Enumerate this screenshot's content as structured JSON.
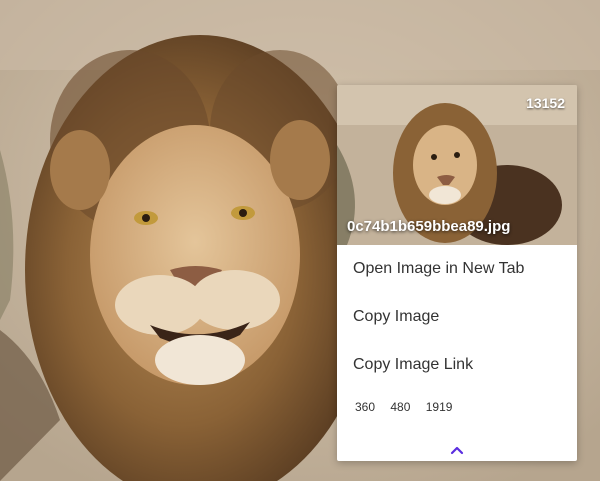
{
  "background_image": {
    "subject": "lion"
  },
  "popup": {
    "thumbnail": {
      "count_badge": "13152",
      "filename": "0c74b1b659bbea89.jpg"
    },
    "menu": {
      "open_new_tab": "Open Image in New Tab",
      "copy_image": "Copy Image",
      "copy_image_link": "Copy Image Link"
    },
    "sizes": [
      "360",
      "480",
      "1919"
    ],
    "collapse_icon": "chevron-up-icon"
  },
  "colors": {
    "accent": "#5b2ee0",
    "menu_text": "#333333",
    "card_bg": "#ffffff"
  }
}
